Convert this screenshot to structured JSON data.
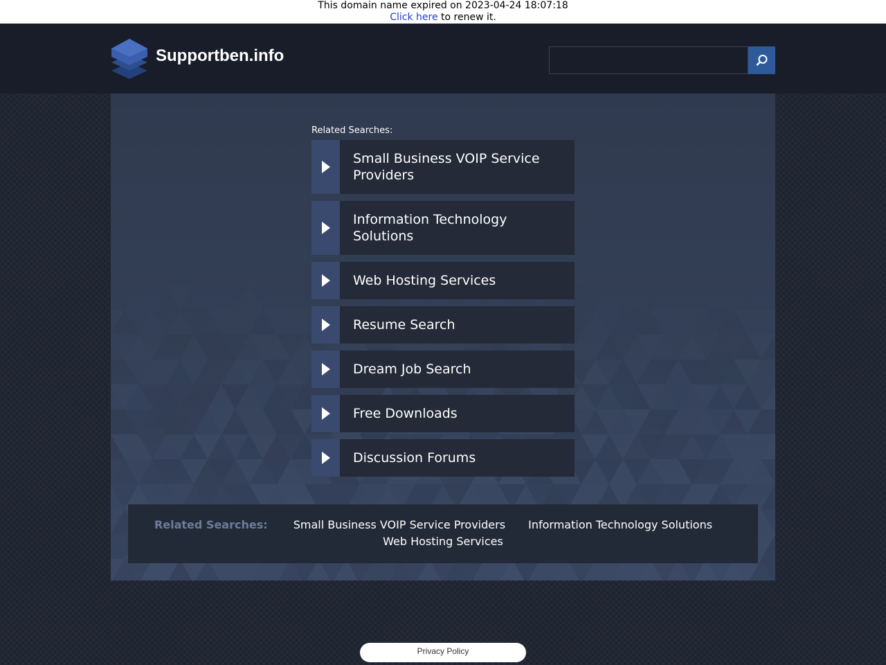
{
  "banner": {
    "expired_text": "This domain name expired on 2023-04-24 18:07:18",
    "renew_link": "Click here",
    "renew_suffix": " to renew it."
  },
  "header": {
    "site_name": "Supportben.info",
    "logo_icon": "stacked-layers-icon",
    "search": {
      "placeholder": "",
      "value": "",
      "button_icon": "search-icon"
    }
  },
  "related": {
    "title": "Related Searches:",
    "items": [
      "Small Business VOIP Service Providers",
      "Information Technology Solutions",
      "Web Hosting Services",
      "Resume Search",
      "Dream Job Search",
      "Free Downloads",
      "Discussion Forums"
    ],
    "arrow_icon": "play-arrow-icon"
  },
  "bottom": {
    "title": "Related Searches:",
    "links": [
      "Small Business VOIP Service Providers",
      "Information Technology Solutions",
      "Web Hosting Services"
    ]
  },
  "footer": {
    "privacy": "Privacy Policy"
  },
  "colors": {
    "page_bg": "#1e2330",
    "header_bg": "#181d29",
    "accent": "#2e5a9a",
    "arrow_box": "#394a6e",
    "link_box": "#242a37",
    "muted_label": "#6c7d99"
  }
}
